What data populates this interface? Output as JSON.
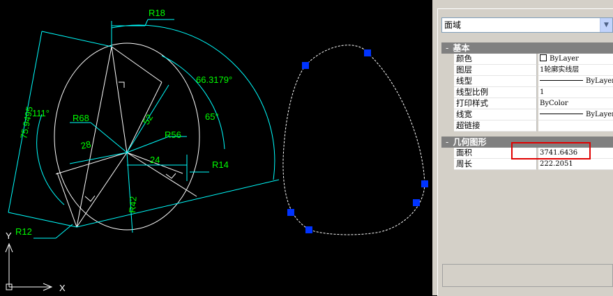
{
  "drawing": {
    "dimensions": {
      "r18": "R18",
      "angle_66": "66.3179°",
      "d75": "75.9495",
      "a111": "111°",
      "a65": "65°",
      "r68": "R68",
      "d52": "52",
      "r56": "R56",
      "d28": "28",
      "d24": "24",
      "r14": "R14",
      "r42": "R42",
      "r12": "R12"
    },
    "ucs": {
      "y": "Y",
      "x": "X"
    }
  },
  "properties": {
    "selected_type": "面域",
    "dropdown_glyph": "▼",
    "basic_section": {
      "sign": "-",
      "title": "基本"
    },
    "basic_rows": [
      {
        "name": "颜色",
        "value": "ByLayer"
      },
      {
        "name": "图层",
        "value": "1轮廓实线层"
      },
      {
        "name": "线型",
        "value": "ByLayer"
      },
      {
        "name": "线型比例",
        "value": "1"
      },
      {
        "name": "打印样式",
        "value": "ByColor"
      },
      {
        "name": "线宽",
        "value": "ByLayer"
      },
      {
        "name": "超链接",
        "value": ""
      }
    ],
    "geometry_section": {
      "sign": "-",
      "title": "几何图形"
    },
    "geometry_rows": [
      {
        "name": "面积",
        "value": "3741.6436"
      },
      {
        "name": "周长",
        "value": "222.2051"
      }
    ]
  },
  "colors": {
    "dimension": "#00ffff",
    "dim_text": "#00ff00",
    "geometry": "#ffffff",
    "grip": "#0033ff",
    "highlight": "#e00000",
    "panel_bg": "#d4d0c8"
  }
}
